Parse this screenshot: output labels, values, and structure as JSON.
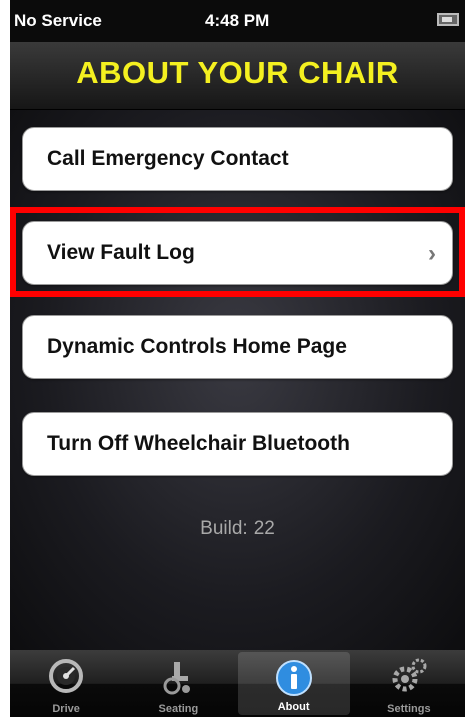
{
  "status_bar": {
    "carrier": "No Service",
    "time": "4:48 PM"
  },
  "header": {
    "title": "ABOUT YOUR CHAIR"
  },
  "menu": {
    "call_emergency": "Call Emergency Contact",
    "view_fault_log": "View Fault Log",
    "home_page": "Dynamic Controls Home Page",
    "bluetooth_off": "Turn Off Wheelchair Bluetooth"
  },
  "build": {
    "label": "Build:",
    "number": "22"
  },
  "tabs": [
    {
      "label": "Drive",
      "icon": "speedometer-icon"
    },
    {
      "label": "Seating",
      "icon": "wheelchair-icon"
    },
    {
      "label": "About",
      "icon": "info-icon"
    },
    {
      "label": "Settings",
      "icon": "gears-icon"
    }
  ],
  "colors": {
    "title": "#f4f020",
    "highlight": "#ff0000",
    "active_info": "#2f8de0"
  }
}
